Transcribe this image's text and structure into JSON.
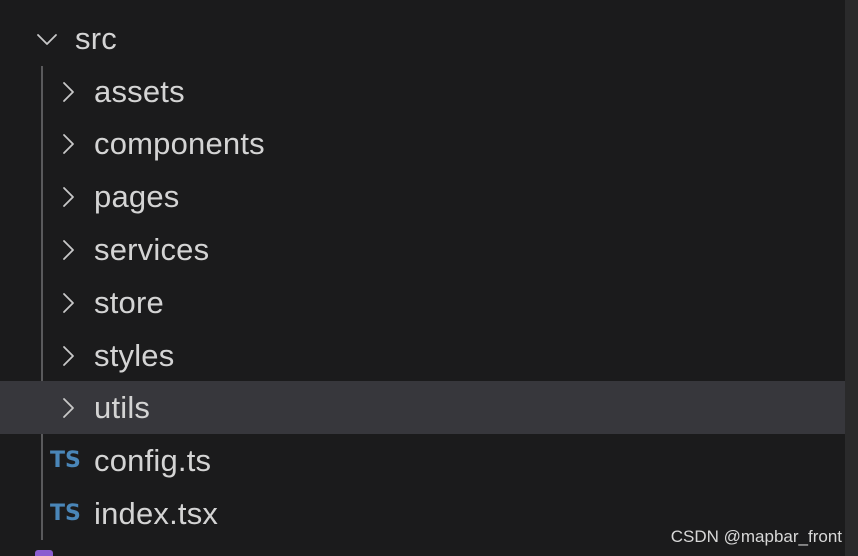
{
  "explorer": {
    "root": {
      "label": "src",
      "expanded": true,
      "icon": "chevron-down-icon"
    },
    "folders": [
      {
        "label": "assets",
        "icon": "chevron-right-icon",
        "expanded": false
      },
      {
        "label": "components",
        "icon": "chevron-right-icon",
        "expanded": false
      },
      {
        "label": "pages",
        "icon": "chevron-right-icon",
        "expanded": false
      },
      {
        "label": "services",
        "icon": "chevron-right-icon",
        "expanded": false
      },
      {
        "label": "store",
        "icon": "chevron-right-icon",
        "expanded": false
      },
      {
        "label": "styles",
        "icon": "chevron-right-icon",
        "expanded": false
      },
      {
        "label": "utils",
        "icon": "chevron-right-icon",
        "expanded": false,
        "selected": true
      }
    ],
    "files": [
      {
        "label": "config.ts",
        "badge": "TS",
        "icon": "typescript-file-icon"
      },
      {
        "label": "index.tsx",
        "badge": "TS",
        "icon": "typescript-file-icon"
      }
    ],
    "partial_next_item": {
      "label": "",
      "icon": "purple-file-icon"
    }
  },
  "watermark": "CSDN @mapbar_front",
  "colors": {
    "background": "#1b1b1c",
    "selected_row": "#37373c",
    "text": "#d4d4d4",
    "ts_badge": "#4a86b8",
    "indent_guide": "#5a5a5c",
    "purple_icon": "#8a5cd0"
  }
}
